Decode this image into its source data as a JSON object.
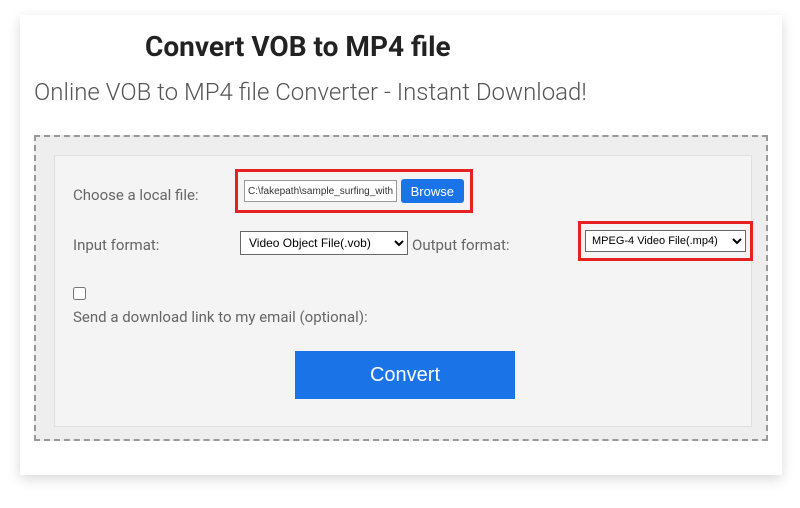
{
  "header": {
    "title": "Convert VOB to MP4 file",
    "subtitle": "Online VOB to MP4 file Converter - Instant Download!"
  },
  "form": {
    "choose_file_label": "Choose a local file:",
    "file_path_value": "C:\\fakepath\\sample_surfing_with_audio.vo",
    "browse_label": "Browse",
    "input_format_label": "Input format:",
    "input_format_value": "Video Object File(.vob)",
    "output_format_label": "Output format:",
    "output_format_value": "MPEG-4 Video File(.mp4)",
    "email_label": "Send a download link to my email (optional):",
    "convert_label": "Convert"
  }
}
